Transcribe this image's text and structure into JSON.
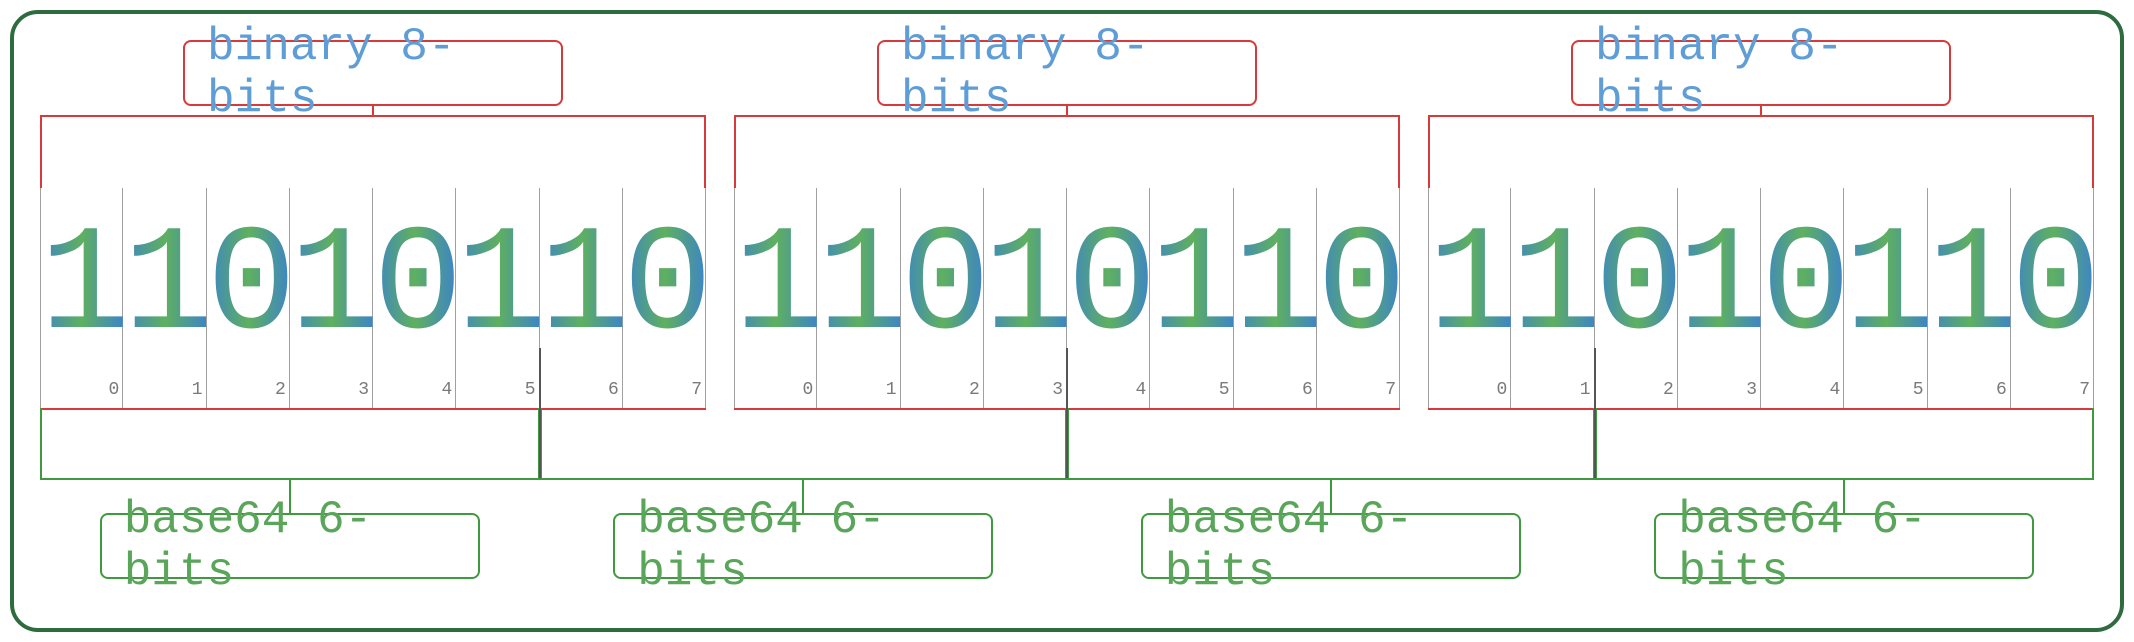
{
  "top_label": "binary 8-bits",
  "bottom_label": "base64 6-bits",
  "bytes": [
    {
      "bits": [
        "1",
        "1",
        "0",
        "1",
        "0",
        "1",
        "1",
        "0"
      ],
      "idx": [
        "0",
        "1",
        "2",
        "3",
        "4",
        "5",
        "6",
        "7"
      ]
    },
    {
      "bits": [
        "1",
        "1",
        "0",
        "1",
        "0",
        "1",
        "1",
        "0"
      ],
      "idx": [
        "0",
        "1",
        "2",
        "3",
        "4",
        "5",
        "6",
        "7"
      ]
    },
    {
      "bits": [
        "1",
        "1",
        "0",
        "1",
        "0",
        "1",
        "1",
        "0"
      ],
      "idx": [
        "0",
        "1",
        "2",
        "3",
        "4",
        "5",
        "6",
        "7"
      ]
    }
  ],
  "b64_groups": 4
}
